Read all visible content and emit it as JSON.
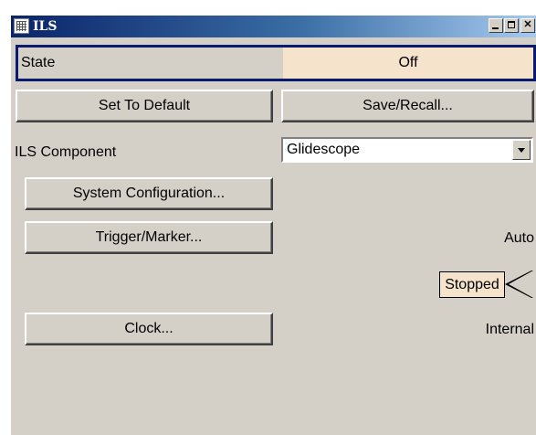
{
  "window": {
    "title": "ILS",
    "controls": {
      "minimize": "minimize",
      "maximize": "maximize",
      "close": "close"
    }
  },
  "state": {
    "label": "State",
    "value": "Off"
  },
  "buttons": {
    "set_to_default": "Set To Default",
    "save_recall": "Save/Recall...",
    "system_configuration": "System Configuration...",
    "trigger_marker": "Trigger/Marker...",
    "clock": "Clock..."
  },
  "ils_component": {
    "label": "ILS Component",
    "selected": "Glidescope"
  },
  "trigger": {
    "mode": "Auto",
    "status": "Stopped"
  },
  "clock": {
    "source": "Internal"
  },
  "colors": {
    "titlebar_start": "#0a246a",
    "titlebar_end": "#a6caf0",
    "highlight": "#f6e3cb",
    "face": "#d4d0c8",
    "focus_border": "#0a1a6e"
  },
  "icons": {
    "window_icon": "table-icon",
    "dropdown": "chevron-down-icon",
    "status_arrow": "arrow-left-icon"
  }
}
